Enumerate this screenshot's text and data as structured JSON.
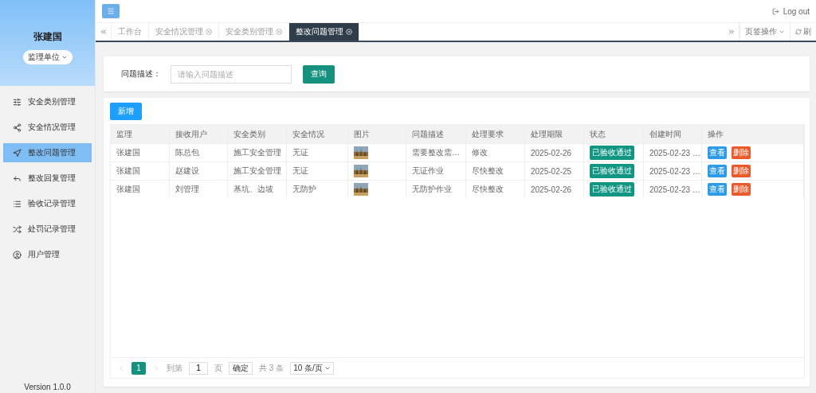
{
  "user": {
    "name": "张建国",
    "role": "监理单位"
  },
  "menu": [
    {
      "label": "安全类别管理",
      "selected": false
    },
    {
      "label": "安全情况管理",
      "selected": false
    },
    {
      "label": "整改问题管理",
      "selected": true
    },
    {
      "label": "整改回复管理",
      "selected": false
    },
    {
      "label": "验收记录管理",
      "selected": false
    },
    {
      "label": "处罚记录管理",
      "selected": false
    },
    {
      "label": "用户管理",
      "selected": false
    }
  ],
  "version": "Version 1.0.0",
  "header": {
    "logout": "Log out"
  },
  "tabs": [
    {
      "label": "工作台",
      "closable": false,
      "selected": false
    },
    {
      "label": "安全情况管理",
      "closable": true,
      "selected": false
    },
    {
      "label": "安全类别管理",
      "closable": true,
      "selected": false
    },
    {
      "label": "整改问题管理",
      "closable": true,
      "selected": true
    }
  ],
  "tab_tools": {
    "page_ops": "页签操作",
    "refresh": "刷"
  },
  "search": {
    "label": "问题描述：",
    "placeholder": "请输入问题描述",
    "button": "查询"
  },
  "add_button": "新增",
  "table": {
    "columns": [
      "监理",
      "接收用户",
      "安全类别",
      "安全情况",
      "图片",
      "问题描述",
      "处理要求",
      "处理期限",
      "状态",
      "创建时间",
      "操作"
    ],
    "rows": [
      {
        "supervisor": "张建国",
        "receiver": "陈总包",
        "category": "施工安全管理",
        "situation": "无证",
        "description": "需要整改需…",
        "requirement": "修改",
        "deadline": "2025-02-26",
        "status": "已验收通过",
        "created": "2025-02-23 …",
        "actions": [
          "查看",
          "删除"
        ]
      },
      {
        "supervisor": "张建国",
        "receiver": "赵建设",
        "category": "施工安全管理",
        "situation": "无证",
        "description": "无证作业",
        "requirement": "尽快整改",
        "deadline": "2025-02-25",
        "status": "已验收通过",
        "created": "2025-02-23 …",
        "actions": [
          "查看",
          "删除"
        ]
      },
      {
        "supervisor": "张建国",
        "receiver": "刘管理",
        "category": "基坑、边坡",
        "situation": "无防护",
        "description": "无防护作业",
        "requirement": "尽快整改",
        "deadline": "2025-02-26",
        "status": "已验收通过",
        "created": "2025-02-23 …",
        "actions": [
          "查看",
          "删除"
        ]
      }
    ]
  },
  "pagination": {
    "pages": [
      {
        "label": "1",
        "selected": true
      }
    ],
    "goto_label": "到第",
    "goto_value": "1",
    "page_unit": "页",
    "confirm": "确定",
    "total": "共 3 条",
    "page_size": "10 条/页"
  }
}
